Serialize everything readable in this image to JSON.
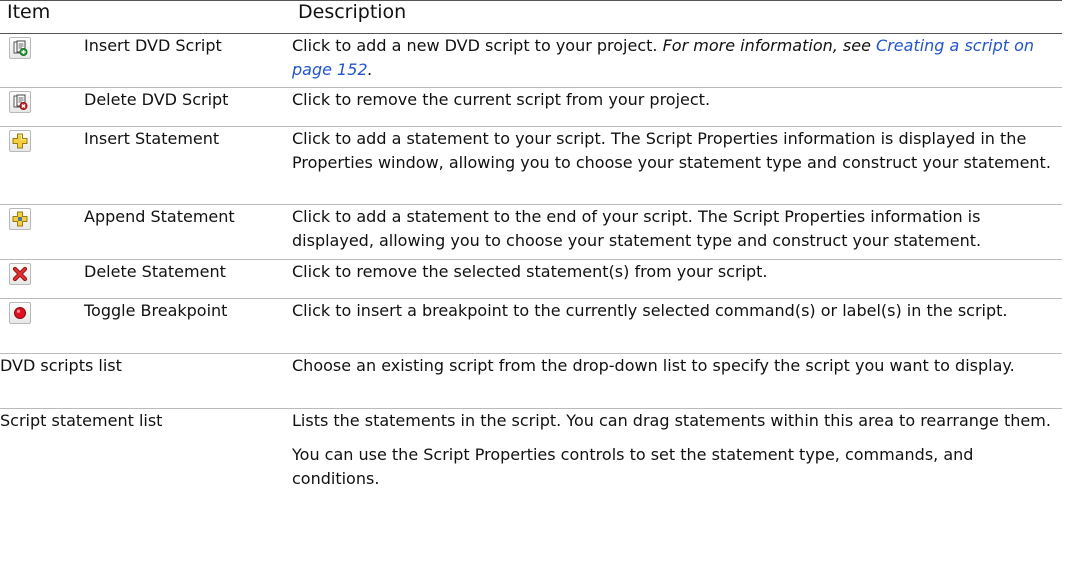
{
  "header": {
    "item": "Item",
    "description": "Description"
  },
  "rows": [
    {
      "icon": "insert-dvd-script-icon",
      "name": "Insert DVD Script",
      "desc": "Click to add a new DVD script to your project.",
      "ref_prefix": "For more information, see",
      "ref_link": "Creating a script on page 152",
      "ref_suffix": "."
    },
    {
      "icon": "delete-dvd-script-icon",
      "name": "Delete DVD Script",
      "desc": "Click to remove the current script from your project."
    },
    {
      "icon": "insert-statement-icon",
      "name": "Insert Statement",
      "desc": "Click to add a statement to your script. The Script Properties information is displayed in the Properties window, allowing you to choose your statement type and construct your statement."
    },
    {
      "icon": "append-statement-icon",
      "name": "Append Statement",
      "desc": "Click to add a statement to the end of your script. The Script Properties information is displayed, allowing you to choose your statement type and construct your statement."
    },
    {
      "icon": "delete-statement-icon",
      "name": "Delete Statement",
      "desc": "Click to remove the selected statement(s) from your script."
    },
    {
      "icon": "toggle-breakpoint-icon",
      "name": "Toggle Breakpoint",
      "desc": "Click to insert a breakpoint to the currently selected command(s) or label(s) in the script."
    }
  ],
  "plain_rows": [
    {
      "name": "DVD scripts list",
      "desc": "Choose an existing script from the drop-down list to specify the script you want to display."
    },
    {
      "name": "Script statement list",
      "desc": "Lists the statements in the script. You can drag statements within this area to rearrange them.",
      "desc2": "You can use the Script Properties controls to set the statement type, commands, and conditions."
    }
  ],
  "colors": {
    "link": "#2255cc",
    "breakpoint": "#dd1122",
    "delete": "#cc1111",
    "plus": "#f2c530"
  }
}
